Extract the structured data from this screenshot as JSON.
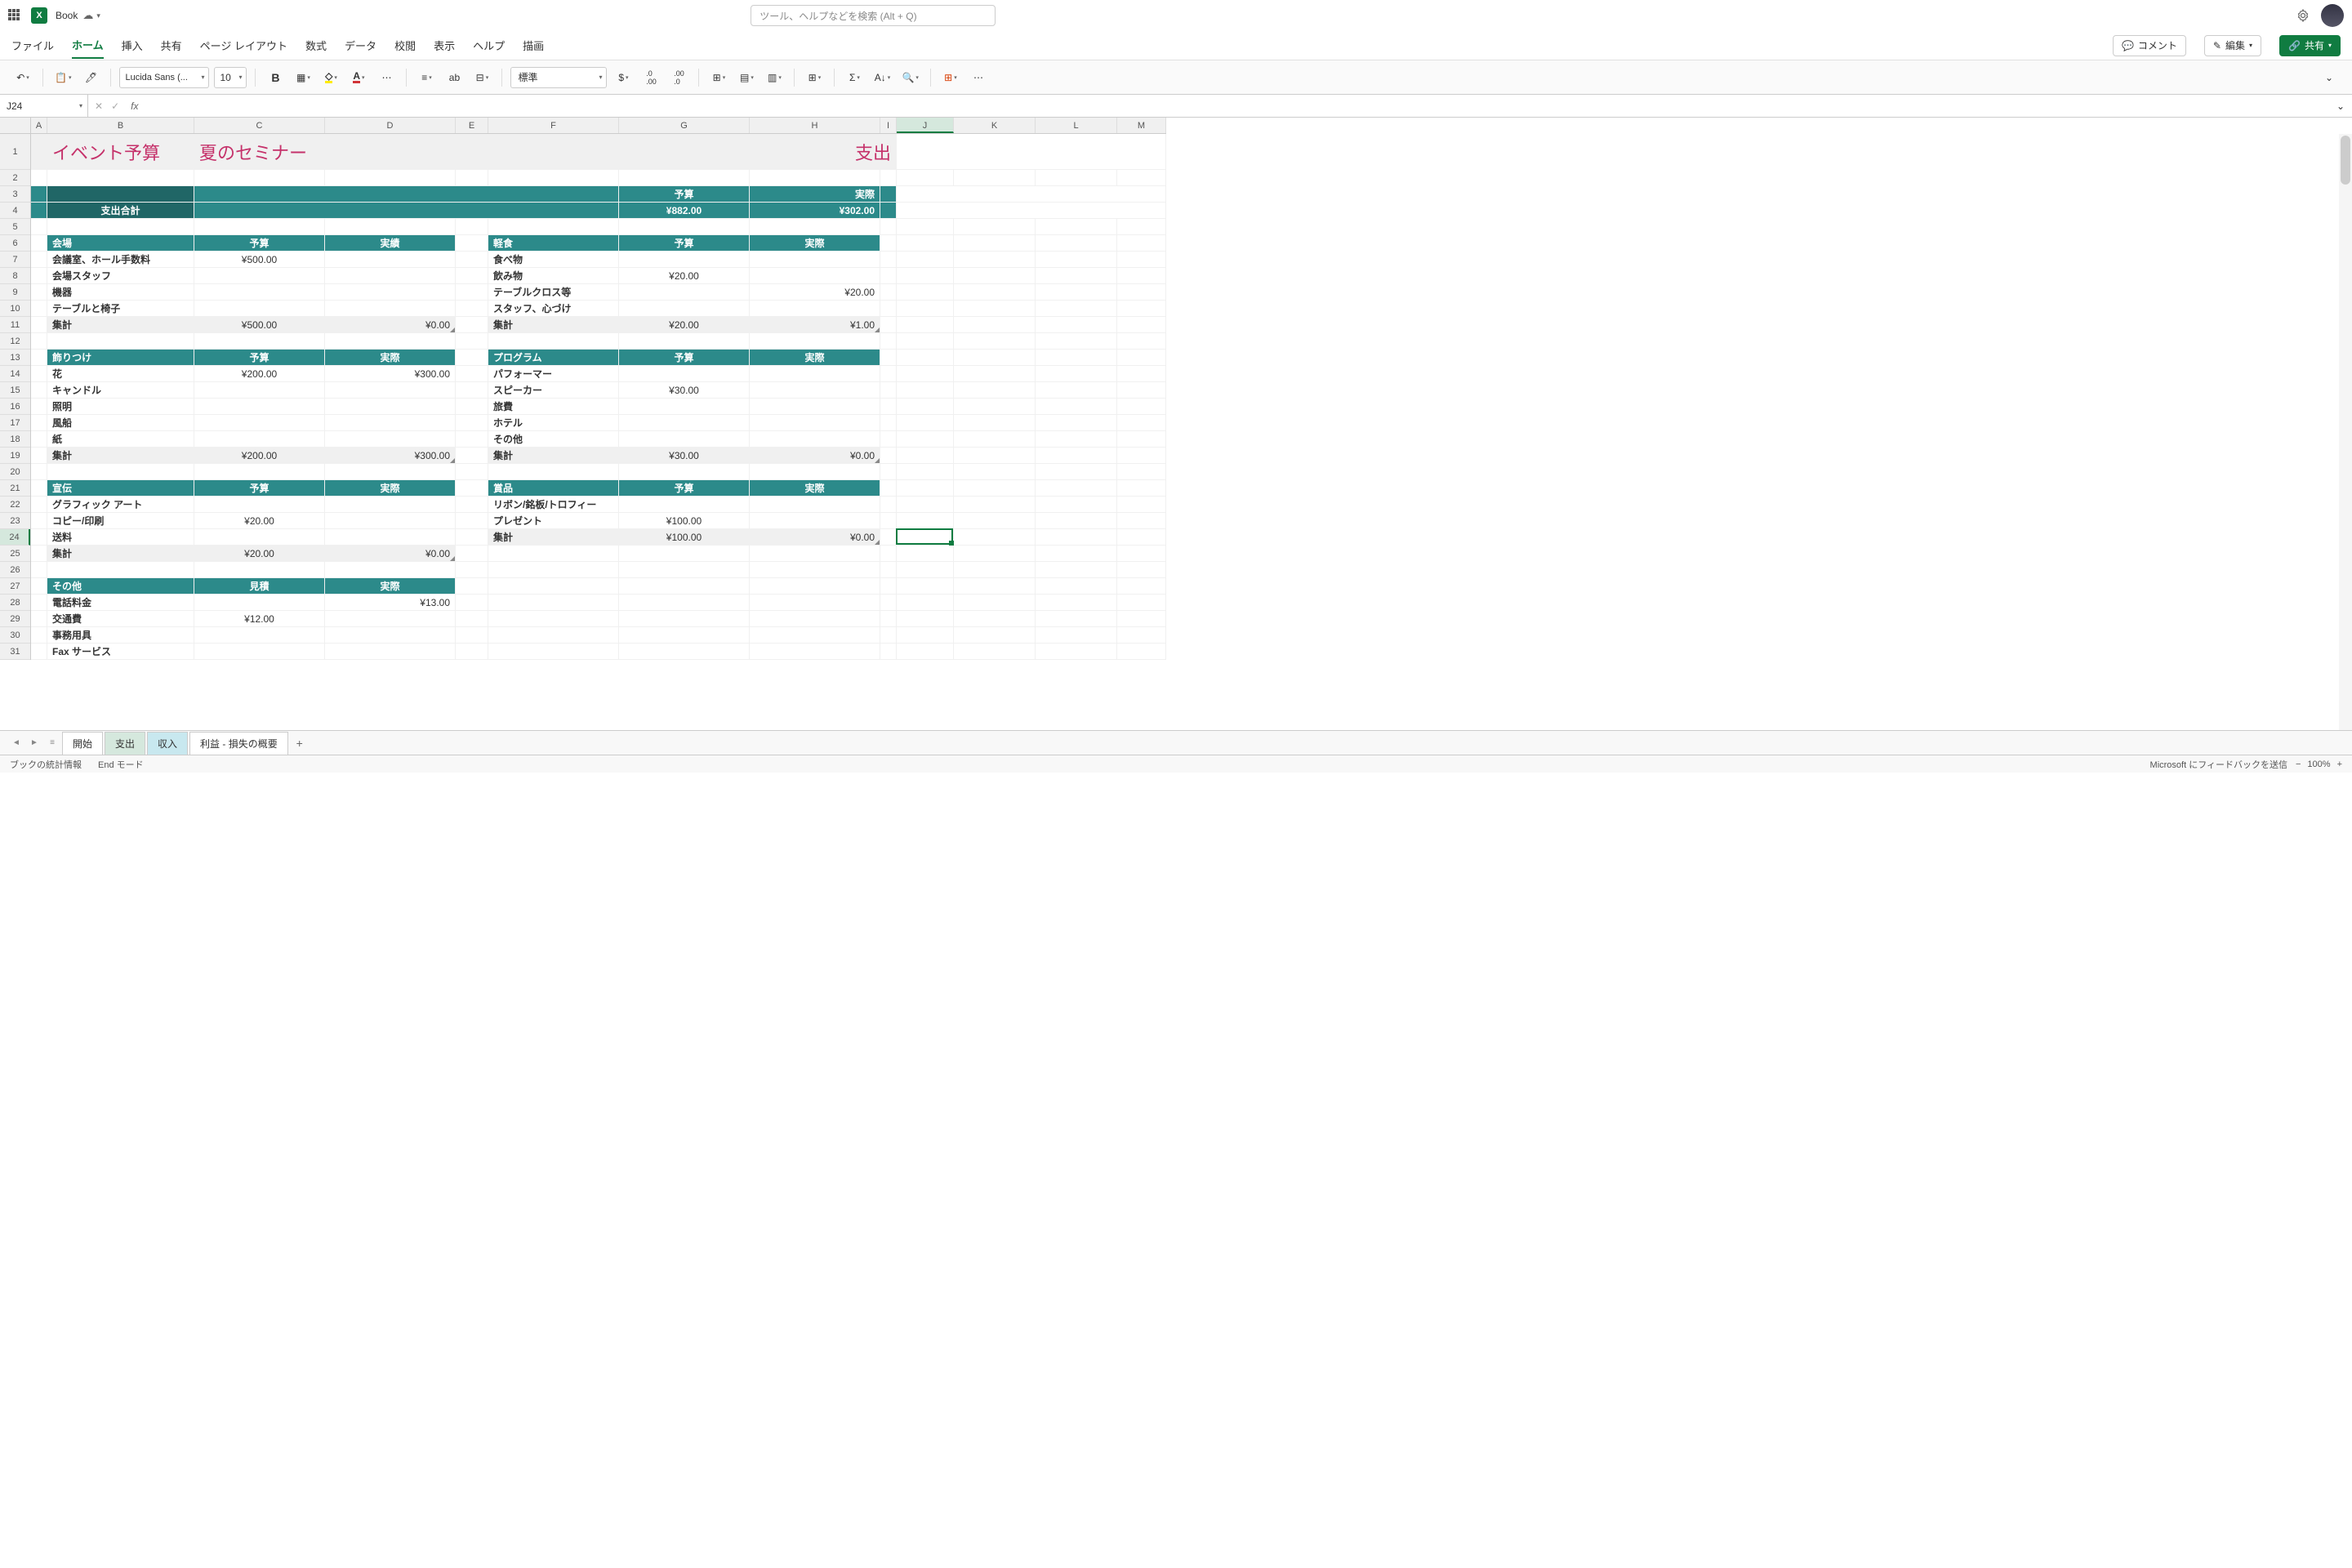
{
  "title": {
    "doc": "Book",
    "search": "ツール、ヘルプなどを検索 (Alt + Q)"
  },
  "menu": {
    "file": "ファイル",
    "home": "ホーム",
    "insert": "挿入",
    "share_m": "共有",
    "layout": "ページ レイアウト",
    "formulas": "数式",
    "data": "データ",
    "review": "校閲",
    "view": "表示",
    "help": "ヘルプ",
    "draw": "描画",
    "comment": "コメント",
    "edit": "編集",
    "share": "共有"
  },
  "ribbon": {
    "font": "Lucida Sans (...",
    "size": "10",
    "format": "標準"
  },
  "namebox": "J24",
  "cols": {
    "A": 20,
    "B": 180,
    "C": 160,
    "D": 160,
    "E": 40,
    "F": 160,
    "G": 160,
    "H": 160,
    "I": 20,
    "J": 70,
    "K": 100,
    "L": 100,
    "M": 60
  },
  "page_title": {
    "left": "イベント予算",
    "mid": "夏のセミナー",
    "right": "支出"
  },
  "totals": {
    "label": "支出合計",
    "h1": "予算",
    "h2": "実際",
    "v1": "¥882.00",
    "v2": "¥302.00"
  },
  "sec1": {
    "name": "会場",
    "h1": "予算",
    "h2": "実績",
    "rows": [
      [
        "会議室、ホール手数料",
        "¥500.00",
        ""
      ],
      [
        "会場スタッフ",
        "",
        ""
      ],
      [
        "機器",
        "",
        ""
      ],
      [
        "テーブルと椅子",
        "",
        ""
      ]
    ],
    "sum": [
      "集計",
      "¥500.00",
      "¥0.00"
    ]
  },
  "sec2": {
    "name": "軽食",
    "h1": "予算",
    "h2": "実際",
    "rows": [
      [
        "食べ物",
        "",
        ""
      ],
      [
        "飲み物",
        "¥20.00",
        ""
      ],
      [
        "テーブルクロス等",
        "",
        "¥20.00"
      ],
      [
        "スタッフ、心づけ",
        "",
        ""
      ]
    ],
    "sum": [
      "集計",
      "¥20.00",
      "¥1.00"
    ]
  },
  "sec3": {
    "name": "飾りつけ",
    "h1": "予算",
    "h2": "実際",
    "rows": [
      [
        "花",
        "¥200.00",
        "¥300.00"
      ],
      [
        "キャンドル",
        "",
        ""
      ],
      [
        "照明",
        "",
        ""
      ],
      [
        "風船",
        "",
        ""
      ],
      [
        "紙",
        "",
        ""
      ]
    ],
    "sum": [
      "集計",
      "¥200.00",
      "¥300.00"
    ]
  },
  "sec4": {
    "name": "プログラム",
    "h1": "予算",
    "h2": "実際",
    "rows": [
      [
        "パフォーマー",
        "",
        ""
      ],
      [
        "スピーカー",
        "¥30.00",
        ""
      ],
      [
        "旅費",
        "",
        ""
      ],
      [
        "ホテル",
        "",
        ""
      ],
      [
        "その他",
        "",
        ""
      ]
    ],
    "sum": [
      "集計",
      "¥30.00",
      "¥0.00"
    ]
  },
  "sec5": {
    "name": "宣伝",
    "h1": "予算",
    "h2": "実際",
    "rows": [
      [
        "グラフィック アート",
        "",
        ""
      ],
      [
        "コピー/印刷",
        "¥20.00",
        ""
      ],
      [
        "送料",
        "",
        ""
      ]
    ],
    "sum": [
      "集計",
      "¥20.00",
      "¥0.00"
    ]
  },
  "sec6": {
    "name": "賞品",
    "h1": "予算",
    "h2": "実際",
    "rows": [
      [
        "リボン/銘板/トロフィー",
        "",
        ""
      ],
      [
        "プレゼント",
        "¥100.00",
        ""
      ]
    ],
    "sum": [
      "集計",
      "¥100.00",
      "¥0.00"
    ]
  },
  "sec7": {
    "name": "その他",
    "h1": "見積",
    "h2": "実際",
    "rows": [
      [
        "電話料金",
        "",
        "¥13.00"
      ],
      [
        "交通費",
        "¥12.00",
        ""
      ],
      [
        "事務用具",
        "",
        ""
      ],
      [
        "Fax サービス",
        "",
        ""
      ]
    ]
  },
  "sheets": {
    "t1": "開始",
    "t2": "支出",
    "t3": "収入",
    "t4": "利益 - 損失の概要"
  },
  "status": {
    "stats": "ブックの統計情報",
    "end": "End モード",
    "feedback": "Microsoft にフィードバックを送信",
    "zoom": "100%"
  }
}
